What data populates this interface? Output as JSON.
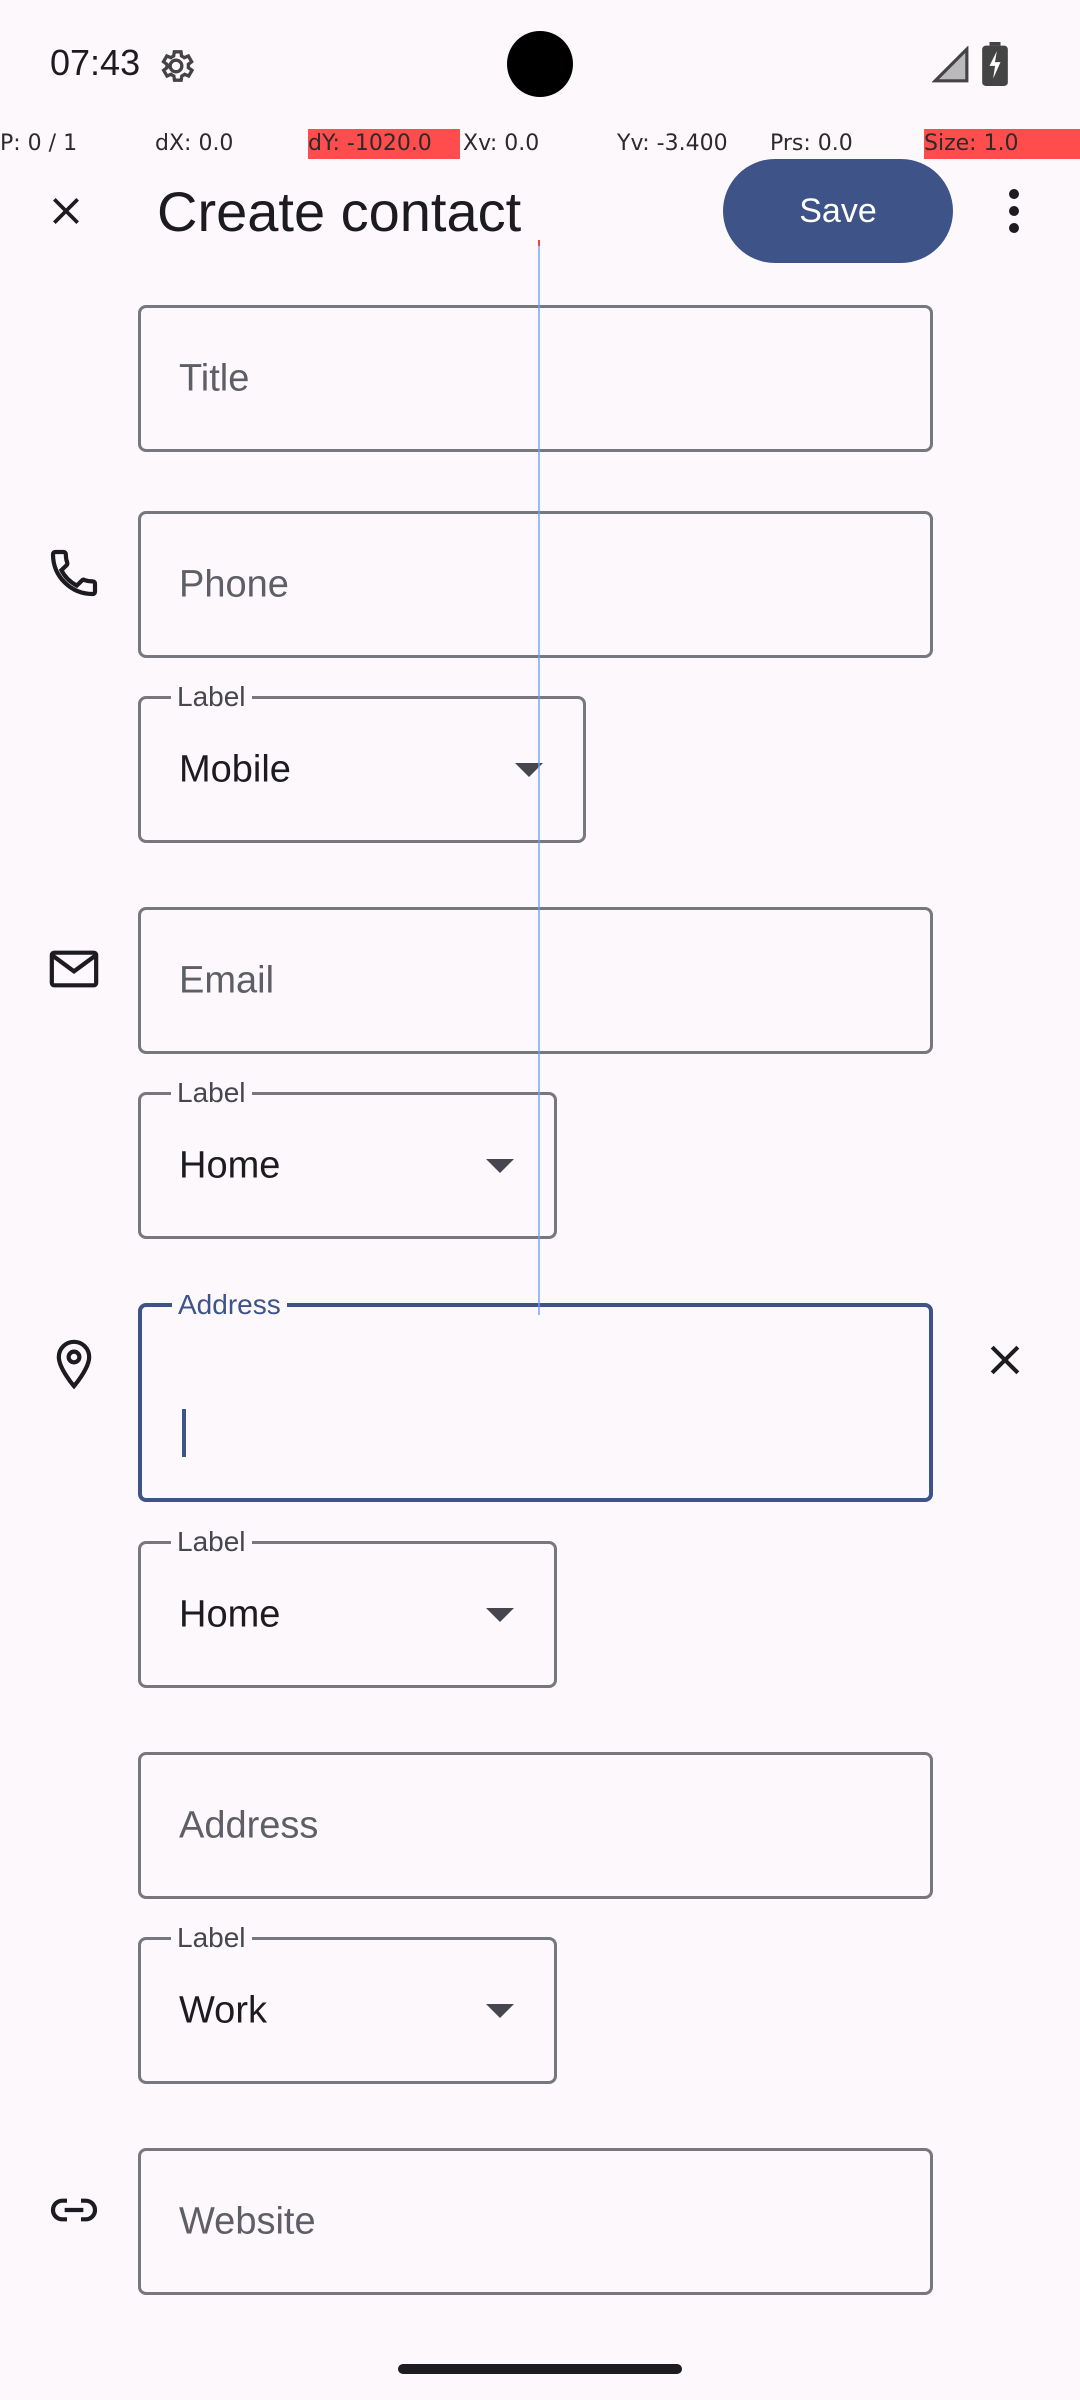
{
  "status_bar": {
    "time": "07:43"
  },
  "debug": {
    "p": "P: 0 / 1",
    "dx": "dX: 0.0",
    "dy": "dY: -1020.0",
    "xv": "Xv: 0.0",
    "yv": "Yv: -3.400",
    "prs": "Prs: 0.0",
    "size": "Size: 1.0"
  },
  "app_bar": {
    "title": "Create contact",
    "save_label": "Save"
  },
  "form": {
    "title_placeholder": "Title",
    "phone_placeholder": "Phone",
    "phone_label": {
      "legend": "Label",
      "value": "Mobile"
    },
    "email_placeholder": "Email",
    "email_label": {
      "legend": "Label",
      "value": "Home"
    },
    "address1": {
      "legend": "Address",
      "value": ""
    },
    "address1_label": {
      "legend": "Label",
      "value": "Home"
    },
    "address2_placeholder": "Address",
    "address2_label": {
      "legend": "Label",
      "value": "Work"
    },
    "website_placeholder": "Website"
  },
  "colors": {
    "accent": "#3E5387",
    "background": "#FCF8FC",
    "outline": "#77777E"
  }
}
